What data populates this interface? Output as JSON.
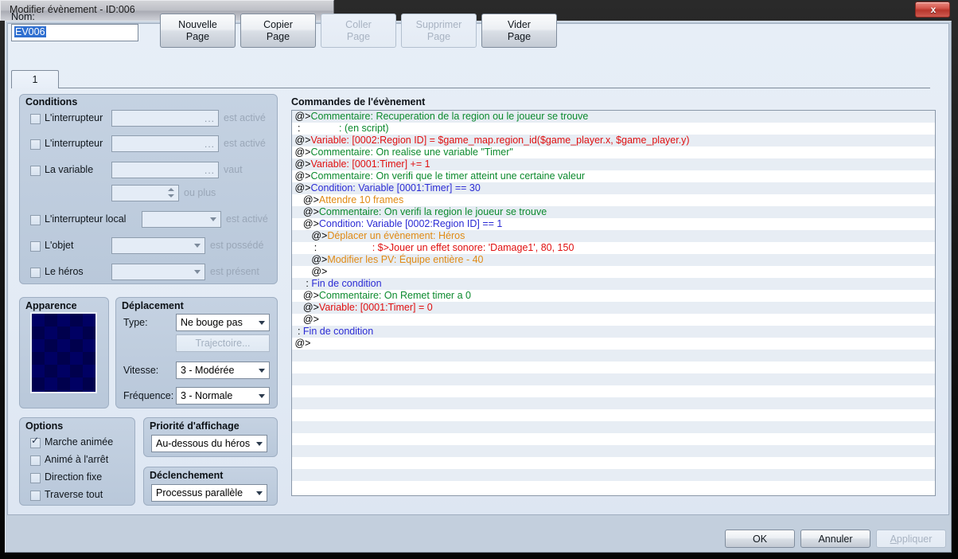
{
  "window": {
    "title": "Modifier évènement - ID:006",
    "close_label": "x"
  },
  "header": {
    "name_label": "Nom:",
    "name_value": "EV006",
    "page_buttons": [
      {
        "label": "Nouvelle\nPage",
        "enabled": true
      },
      {
        "label": "Copier\nPage",
        "enabled": true
      },
      {
        "label": "Coller\nPage",
        "enabled": false
      },
      {
        "label": "Supprimer\nPage",
        "enabled": false
      },
      {
        "label": "Vider\nPage",
        "enabled": true
      }
    ],
    "tab_label": "1"
  },
  "conditions": {
    "title": "Conditions",
    "rows": [
      {
        "label": "L'interrupteur",
        "checked": false,
        "control": "field",
        "value": "",
        "suffix": "est activé"
      },
      {
        "label": "L'interrupteur",
        "checked": false,
        "control": "field",
        "value": "",
        "suffix": "est activé"
      },
      {
        "label": "La variable",
        "checked": false,
        "control": "field",
        "value": "",
        "suffix": "vaut"
      },
      {
        "label": "",
        "checked": null,
        "control": "spinner",
        "value": "",
        "suffix": "ou plus"
      },
      {
        "label": "L'interrupteur local",
        "checked": false,
        "control": "combo",
        "value": "",
        "suffix": "est activé"
      },
      {
        "label": "L'objet",
        "checked": false,
        "control": "combo",
        "value": "",
        "suffix": "est possédé"
      },
      {
        "label": "Le héros",
        "checked": false,
        "control": "combo",
        "value": "",
        "suffix": "est présent"
      }
    ],
    "browse_dots": "..."
  },
  "apparence": {
    "title": "Apparence"
  },
  "deplacement": {
    "title": "Déplacement",
    "type_label": "Type:",
    "type_value": "Ne bouge pas",
    "route_button": "Trajectoire...",
    "route_enabled": false,
    "speed_label": "Vitesse:",
    "speed_value": "3 - Modérée",
    "freq_label": "Fréquence:",
    "freq_value": "3 - Normale"
  },
  "options": {
    "title": "Options",
    "items": [
      {
        "label": "Marche animée",
        "checked": true
      },
      {
        "label": "Animé à l'arrêt",
        "checked": false
      },
      {
        "label": "Direction fixe",
        "checked": false
      },
      {
        "label": "Traverse tout",
        "checked": false
      }
    ]
  },
  "priority": {
    "title": "Priorité d'affichage",
    "value": "Au-dessous du héros"
  },
  "trigger": {
    "title": "Déclenchement",
    "value": "Processus parallèle"
  },
  "commands": {
    "title": "Commandes de l'évènement",
    "total_rows": 32,
    "lines": [
      {
        "indent": 0,
        "marker": "@>",
        "text": "Commentaire: Recuperation de la region ou le joueur se trouve",
        "color": "green"
      },
      {
        "indent": 0,
        "marker": " :",
        "text": "              : (en script)",
        "color": "green"
      },
      {
        "indent": 0,
        "marker": "@>",
        "text": "Variable: [0002:Region ID] = $game_map.region_id($game_player.x, $game_player.y)",
        "color": "red"
      },
      {
        "indent": 0,
        "marker": "@>",
        "text": "Commentaire: On realise une variable \"Timer\"",
        "color": "green"
      },
      {
        "indent": 0,
        "marker": "@>",
        "text": "Variable: [0001:Timer] += 1",
        "color": "red"
      },
      {
        "indent": 0,
        "marker": "@>",
        "text": "Commentaire: On verifi que le timer atteint une certaine valeur",
        "color": "green"
      },
      {
        "indent": 0,
        "marker": "@>",
        "text": "Condition: Variable [0001:Timer] == 30",
        "color": "blue"
      },
      {
        "indent": 1,
        "marker": "@>",
        "text": "Attendre 10 frames",
        "color": "orange"
      },
      {
        "indent": 1,
        "marker": "@>",
        "text": "Commentaire: On verifi la region le joueur se trouve",
        "color": "green"
      },
      {
        "indent": 1,
        "marker": "@>",
        "text": "Condition: Variable [0002:Region ID] == 1",
        "color": "blue"
      },
      {
        "indent": 2,
        "marker": "@>",
        "text": "Déplacer un évènement: Héros",
        "color": "orange"
      },
      {
        "indent": 2,
        "marker": " :",
        "text": "                    : $>Jouer un effet sonore: 'Damage1', 80, 150",
        "color": "red"
      },
      {
        "indent": 2,
        "marker": "@>",
        "text": "Modifier les PV: Équipe entière - 40",
        "color": "orange"
      },
      {
        "indent": 2,
        "marker": "@>",
        "text": "",
        "color": "dark"
      },
      {
        "indent": 1,
        "marker": " :",
        "text": " Fin de condition",
        "color": "blue"
      },
      {
        "indent": 1,
        "marker": "@>",
        "text": "Commentaire: On Remet timer a 0",
        "color": "green"
      },
      {
        "indent": 1,
        "marker": "@>",
        "text": "Variable: [0001:Timer] = 0",
        "color": "red"
      },
      {
        "indent": 1,
        "marker": "@>",
        "text": "",
        "color": "dark"
      },
      {
        "indent": 0,
        "marker": " :",
        "text": " Fin de condition",
        "color": "blue"
      },
      {
        "indent": 0,
        "marker": "@>",
        "text": "",
        "color": "dark"
      }
    ]
  },
  "footer": {
    "ok": "OK",
    "cancel": "Annuler",
    "apply": "Appliquer",
    "apply_enabled": false
  }
}
